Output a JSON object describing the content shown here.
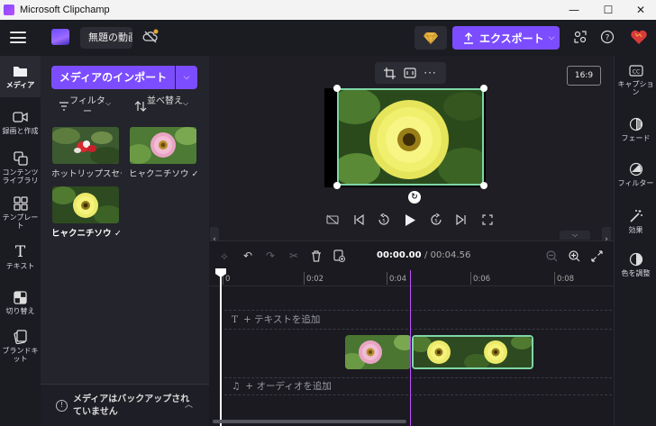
{
  "window": {
    "title": "Microsoft Clipchamp",
    "minimize": "—",
    "maximize": "☐",
    "close": "✕"
  },
  "header": {
    "project_name": "無題の動画",
    "export_label": "エクスポート",
    "colors": {
      "accent": "#7c4dff",
      "header_bg": "#1b1b22"
    }
  },
  "left_nav": [
    {
      "label": "メディア",
      "icon": "folder-icon",
      "active": true
    },
    {
      "label": "録画と作成",
      "icon": "video-camera-icon"
    },
    {
      "label": "コンテンツライブラリ",
      "icon": "content-library-icon"
    },
    {
      "label": "テンプレート",
      "icon": "template-grid-icon"
    },
    {
      "label": "テキスト",
      "icon": "text-T-icon"
    },
    {
      "label": "切り替え",
      "icon": "transition-icon"
    },
    {
      "label": "ブランドキット",
      "icon": "brand-kit-icon"
    }
  ],
  "media": {
    "import_label": "メディアのインポート",
    "filter_label": "フィルター",
    "sort_label": "並べ替え",
    "items": [
      {
        "label": "ホットリップスセージ",
        "used": false
      },
      {
        "label": "ヒャクニチソウ",
        "used": true
      },
      {
        "label": "ヒャクニチソウ",
        "used": true,
        "selected": true
      }
    ],
    "backup_message": "メディアはバックアップされていません"
  },
  "preview": {
    "aspect_ratio": "16:9"
  },
  "right_panel": [
    {
      "label": "キャプション",
      "icon": "cc-icon"
    },
    {
      "label": "フェード",
      "icon": "fade-icon"
    },
    {
      "label": "フィルター",
      "icon": "filter-icon"
    },
    {
      "label": "効果",
      "icon": "magic-wand-icon"
    },
    {
      "label": "色を調整",
      "icon": "color-adjust-icon"
    }
  ],
  "timeline": {
    "current_time": "00:00.00",
    "total_time": "/ 00:04.56",
    "ruler_ticks": [
      "0",
      "0:02",
      "0:04",
      "0:06",
      "0:08"
    ],
    "text_track_label": "+ テキストを追加",
    "audio_track_label": "+ オーディオを追加"
  }
}
